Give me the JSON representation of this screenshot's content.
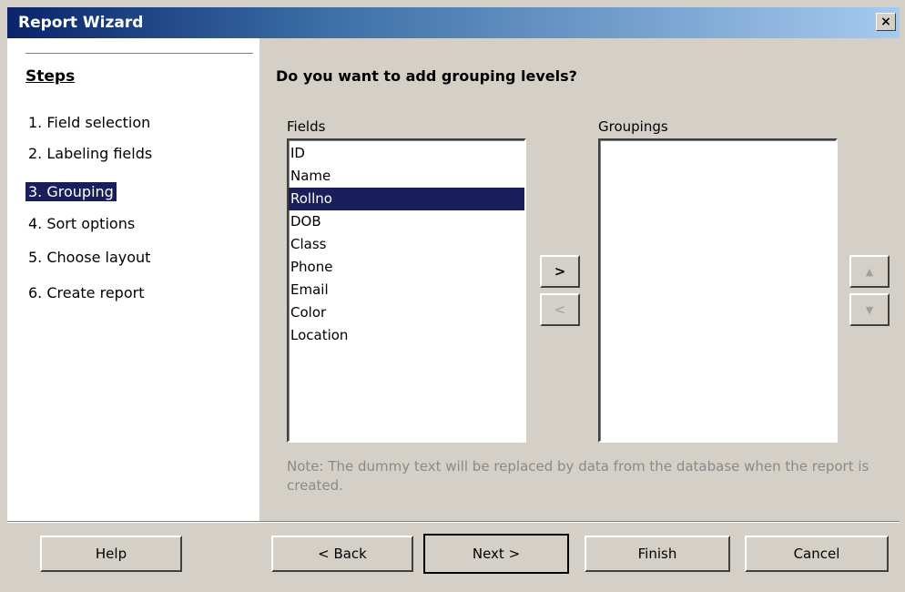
{
  "window": {
    "title": "Report Wizard",
    "close": "×"
  },
  "steps": {
    "title": "Steps",
    "items": [
      {
        "label": "1. Field selection"
      },
      {
        "label": "2. Labeling fields"
      },
      {
        "label": "3. Grouping"
      },
      {
        "label": "4. Sort options"
      },
      {
        "label": "5. Choose layout"
      },
      {
        "label": "6. Create report"
      }
    ],
    "active_index": 2
  },
  "main": {
    "question": "Do you want to add grouping levels?",
    "fields_label": "Fields",
    "groupings_label": "Groupings",
    "fields": [
      "ID",
      "Name",
      "Rollno",
      "DOB",
      "Class",
      "Phone",
      "Email",
      "Color",
      "Location"
    ],
    "selected_field": "Rollno",
    "groupings": [],
    "add_button": ">",
    "remove_button": "<",
    "up_button": "▲",
    "down_button": "▼",
    "note": "Note: The dummy text will be replaced by data from the database when the report is created."
  },
  "footer": {
    "help": "Help",
    "back": "< Back",
    "next": "Next >",
    "finish": "Finish",
    "cancel": "Cancel"
  }
}
